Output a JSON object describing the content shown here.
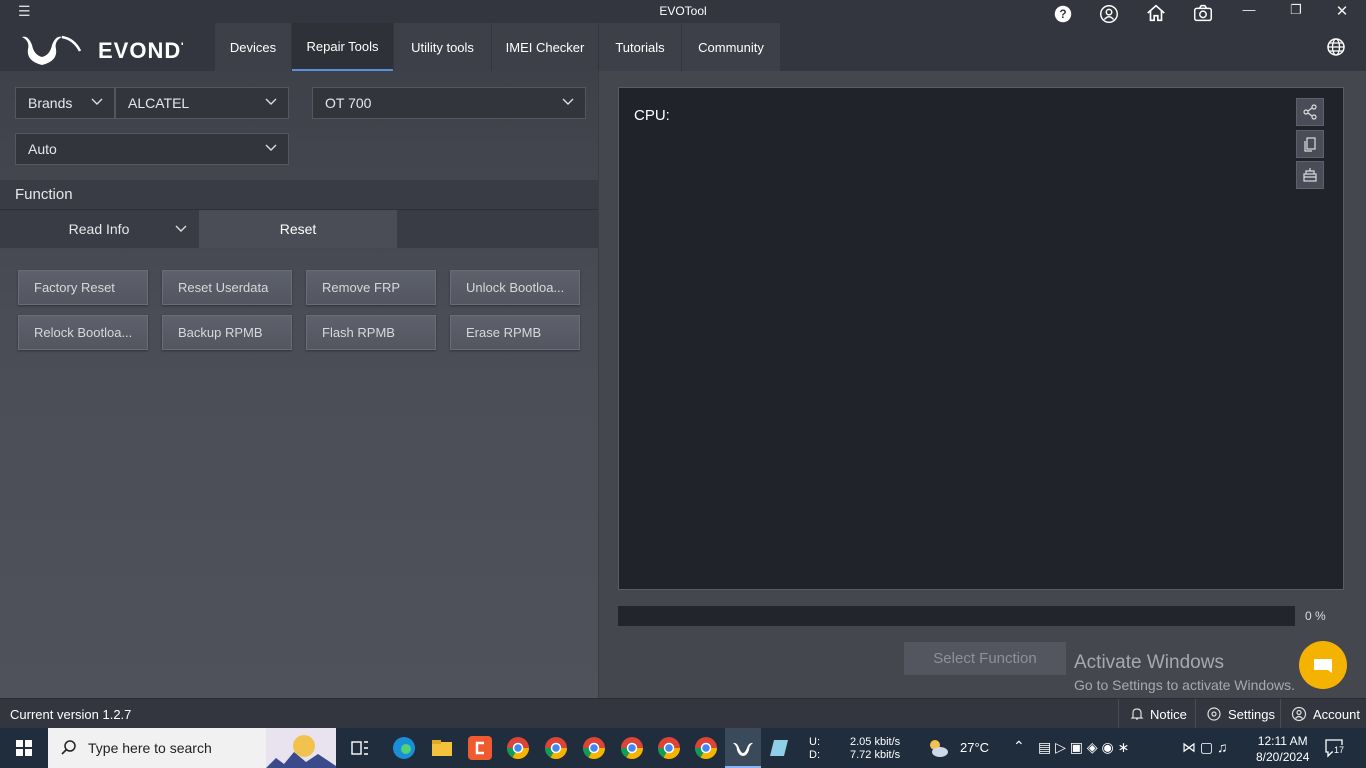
{
  "window": {
    "title": "EVOTool"
  },
  "nav": {
    "tabs": [
      {
        "label": "Devices"
      },
      {
        "label": "Repair Tools"
      },
      {
        "label": "Utility tools"
      },
      {
        "label": "IMEI Checker"
      },
      {
        "label": "Tutorials"
      },
      {
        "label": "Community"
      }
    ],
    "active_tab": "Repair Tools"
  },
  "selectors": {
    "brands_label": "Brands",
    "brand_value": "ALCATEL",
    "model_value": "OT 700",
    "mode_value": "Auto"
  },
  "function": {
    "header": "Function",
    "subtabs": [
      {
        "label": "Read Info"
      },
      {
        "label": "Reset"
      }
    ],
    "active_subtab": "Reset",
    "buttons": [
      {
        "label": "Factory Reset"
      },
      {
        "label": "Reset Userdata"
      },
      {
        "label": "Remove FRP"
      },
      {
        "label": "Unlock Bootloa..."
      },
      {
        "label": "Relock Bootloa..."
      },
      {
        "label": "Backup RPMB"
      },
      {
        "label": "Flash RPMB"
      },
      {
        "label": "Erase RPMB"
      }
    ]
  },
  "console": {
    "cpu_label": "CPU:"
  },
  "progress": {
    "value": 0,
    "label": "0 %"
  },
  "select_function_label": "Select Function",
  "watermark": {
    "line1": "Activate Windows",
    "line2": "Go to Settings to activate Windows."
  },
  "statusbar": {
    "version": "Current version 1.2.7",
    "notice": "Notice",
    "settings": "Settings",
    "account": "Account"
  },
  "taskbar": {
    "search_placeholder": "Type here to search",
    "net_up_label": "U:",
    "net_down_label": "D:",
    "net_up": "2.05 kbit/s",
    "net_down": "7.72 kbit/s",
    "temperature": "27°C",
    "time": "12:11 AM",
    "date": "8/20/2024",
    "notification_count": "17"
  },
  "colors": {
    "accent": "#5b8fd6",
    "chat": "#f5b301",
    "panel": "#45474f",
    "console": "#21232b"
  }
}
